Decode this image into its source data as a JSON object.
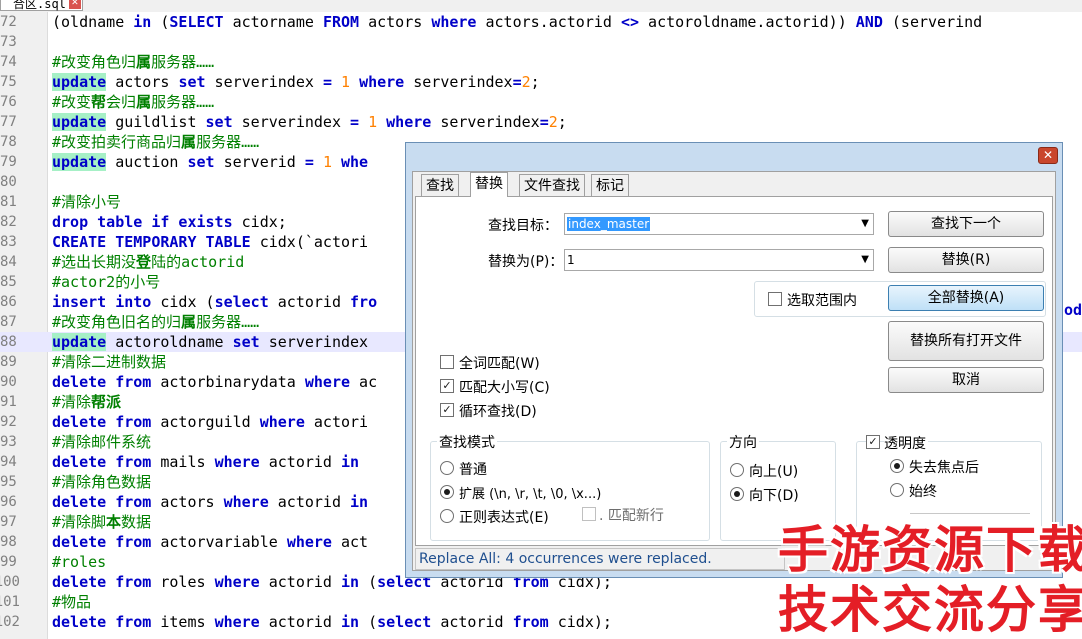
{
  "editor": {
    "tab": {
      "title": "合区.sql",
      "close_icon": "close-icon"
    },
    "lines": [
      {
        "n": "72",
        "tokens": [
          [
            "t",
            "(oldname "
          ],
          [
            "k",
            "in"
          ],
          [
            "t",
            " ("
          ],
          [
            "k",
            "SELECT"
          ],
          [
            "t",
            " actorname "
          ],
          [
            "k",
            "FROM"
          ],
          [
            "t",
            " actors "
          ],
          [
            "k",
            "where"
          ],
          [
            "t",
            " actors.actorid "
          ],
          [
            "k",
            "<>"
          ],
          [
            "t",
            " actoroldname.actorid)) "
          ],
          [
            "k",
            "AND"
          ],
          [
            "t",
            " (serverind"
          ]
        ]
      },
      {
        "n": "73",
        "tokens": []
      },
      {
        "n": "74",
        "tokens": [
          [
            "c",
            "#改变角色归"
          ],
          [
            "cb",
            "属"
          ],
          [
            "c",
            "服务器……"
          ]
        ]
      },
      {
        "n": "75",
        "tokens": [
          [
            "h",
            "update"
          ],
          [
            "t",
            " actors "
          ],
          [
            "k",
            "set"
          ],
          [
            "t",
            " serverindex "
          ],
          [
            "k",
            "="
          ],
          [
            "t",
            " "
          ],
          [
            "n",
            "1"
          ],
          [
            "t",
            " "
          ],
          [
            "k",
            "where"
          ],
          [
            "t",
            " serverindex"
          ],
          [
            "k",
            "="
          ],
          [
            "n",
            "2"
          ],
          [
            "t",
            ";"
          ]
        ]
      },
      {
        "n": "76",
        "tokens": [
          [
            "c",
            "#改变"
          ],
          [
            "cb",
            "帮"
          ],
          [
            "c",
            "会归"
          ],
          [
            "cb",
            "属"
          ],
          [
            "c",
            "服务器……"
          ]
        ]
      },
      {
        "n": "77",
        "tokens": [
          [
            "h",
            "update"
          ],
          [
            "t",
            " guildlist "
          ],
          [
            "k",
            "set"
          ],
          [
            "t",
            " serverindex "
          ],
          [
            "k",
            "="
          ],
          [
            "t",
            " "
          ],
          [
            "n",
            "1"
          ],
          [
            "t",
            " "
          ],
          [
            "k",
            "where"
          ],
          [
            "t",
            " serverindex"
          ],
          [
            "k",
            "="
          ],
          [
            "n",
            "2"
          ],
          [
            "t",
            ";"
          ]
        ]
      },
      {
        "n": "78",
        "tokens": [
          [
            "c",
            "#改变拍卖行商品归"
          ],
          [
            "cb",
            "属"
          ],
          [
            "c",
            "服务器……"
          ]
        ]
      },
      {
        "n": "79",
        "tokens": [
          [
            "h",
            "update"
          ],
          [
            "t",
            " auction "
          ],
          [
            "k",
            "set"
          ],
          [
            "t",
            " serverid "
          ],
          [
            "k",
            "="
          ],
          [
            "t",
            " "
          ],
          [
            "n",
            "1"
          ],
          [
            "t",
            " "
          ],
          [
            "k",
            "whe"
          ]
        ]
      },
      {
        "n": "80",
        "tokens": []
      },
      {
        "n": "81",
        "tokens": [
          [
            "c",
            "#清除小号"
          ]
        ]
      },
      {
        "n": "82",
        "tokens": [
          [
            "k",
            "drop table if exists"
          ],
          [
            "t",
            " cidx;"
          ]
        ]
      },
      {
        "n": "83",
        "tokens": [
          [
            "k",
            "CREATE TEMPORARY TABLE"
          ],
          [
            "t",
            " cidx(`actori"
          ]
        ]
      },
      {
        "n": "84",
        "tokens": [
          [
            "c",
            "#选出长期没"
          ],
          [
            "cb",
            "登"
          ],
          [
            "c",
            "陆的actorid"
          ]
        ]
      },
      {
        "n": "85",
        "tokens": [
          [
            "c",
            "#actor2的小号"
          ]
        ]
      },
      {
        "n": "86",
        "tokens": [
          [
            "k",
            "insert into"
          ],
          [
            "t",
            " cidx ("
          ],
          [
            "k",
            "select"
          ],
          [
            "t",
            " actorid "
          ],
          [
            "k",
            "fro"
          ]
        ]
      },
      {
        "n": "87",
        "tokens": [
          [
            "c",
            "#改变角色旧名的归"
          ],
          [
            "cb",
            "属"
          ],
          [
            "c",
            "服务器……"
          ]
        ]
      },
      {
        "n": "88",
        "tokens": [
          [
            "h",
            "update"
          ],
          [
            "t",
            " actoroldname "
          ],
          [
            "k",
            "set"
          ],
          [
            "t",
            " serverindex "
          ]
        ],
        "hl": true
      },
      {
        "n": "89",
        "tokens": [
          [
            "c",
            "#清除二进制数据"
          ]
        ]
      },
      {
        "n": "90",
        "tokens": [
          [
            "k",
            "delete from"
          ],
          [
            "t",
            " actorbinarydata "
          ],
          [
            "k",
            "where"
          ],
          [
            "t",
            " ac"
          ]
        ]
      },
      {
        "n": "91",
        "tokens": [
          [
            "c",
            "#清除"
          ],
          [
            "cb",
            "帮派"
          ]
        ]
      },
      {
        "n": "92",
        "tokens": [
          [
            "k",
            "delete from"
          ],
          [
            "t",
            " actorguild "
          ],
          [
            "k",
            "where"
          ],
          [
            "t",
            " actori"
          ]
        ]
      },
      {
        "n": "93",
        "tokens": [
          [
            "c",
            "#清除邮件系统"
          ]
        ]
      },
      {
        "n": "94",
        "tokens": [
          [
            "k",
            "delete from"
          ],
          [
            "t",
            " mails "
          ],
          [
            "k",
            "where"
          ],
          [
            "t",
            " actorid "
          ],
          [
            "k",
            "in"
          ]
        ]
      },
      {
        "n": "95",
        "tokens": [
          [
            "c",
            "#清除角色数据"
          ]
        ]
      },
      {
        "n": "96",
        "tokens": [
          [
            "k",
            "delete from"
          ],
          [
            "t",
            " actors "
          ],
          [
            "k",
            "where"
          ],
          [
            "t",
            " actorid "
          ],
          [
            "k",
            "in"
          ]
        ]
      },
      {
        "n": "97",
        "tokens": [
          [
            "c",
            "#清除脚"
          ],
          [
            "cb",
            "本"
          ],
          [
            "c",
            "数据"
          ]
        ]
      },
      {
        "n": "98",
        "tokens": [
          [
            "k",
            "delete from"
          ],
          [
            "t",
            " actorvariable "
          ],
          [
            "k",
            "where"
          ],
          [
            "t",
            " act"
          ]
        ]
      },
      {
        "n": "99",
        "tokens": [
          [
            "c",
            "#roles"
          ]
        ]
      },
      {
        "n": "100",
        "tokens": [
          [
            "k",
            "delete from"
          ],
          [
            "t",
            " roles "
          ],
          [
            "k",
            "where"
          ],
          [
            "t",
            " actorid "
          ],
          [
            "k",
            "in"
          ],
          [
            "t",
            " ("
          ],
          [
            "k",
            "select"
          ],
          [
            "t",
            " actorid "
          ],
          [
            "k",
            "from"
          ],
          [
            "t",
            " cidx);"
          ]
        ]
      },
      {
        "n": "101",
        "tokens": [
          [
            "c",
            "#物品"
          ]
        ]
      },
      {
        "n": "102",
        "tokens": [
          [
            "k",
            "delete from"
          ],
          [
            "t",
            " items "
          ],
          [
            "k",
            "where"
          ],
          [
            "t",
            " actorid "
          ],
          [
            "k",
            "in"
          ],
          [
            "t",
            " ("
          ],
          [
            "k",
            "select"
          ],
          [
            "t",
            " actorid "
          ],
          [
            "k",
            "from"
          ],
          [
            "t",
            " cidx);"
          ]
        ]
      }
    ],
    "right_edge_fragment": "od"
  },
  "dialog": {
    "close_icon": "close-icon",
    "tabs": [
      {
        "label": "查找",
        "active": false
      },
      {
        "label": "替换",
        "active": true
      },
      {
        "label": "文件查找",
        "active": false
      },
      {
        "label": "标记",
        "active": false
      }
    ],
    "find_label": "查找目标：",
    "find_value": "index_master",
    "replace_label": "替换为(P)：",
    "replace_value": "1",
    "buttons": {
      "find_next": "查找下一个",
      "replace": "替换(R)",
      "replace_all": "全部替换(A)",
      "replace_all_open": "替换所有打开文件",
      "cancel": "取消"
    },
    "in_selection": {
      "label": "选取范围内",
      "checked": false
    },
    "options": [
      {
        "label": "全词匹配(W)",
        "checked": false
      },
      {
        "label": "匹配大小写(C)",
        "checked": true
      },
      {
        "label": "循环查找(D)",
        "checked": true
      }
    ],
    "search_mode": {
      "title": "查找模式",
      "items": [
        {
          "label": "普通",
          "checked": false
        },
        {
          "label": "扩展 (\\n, \\r, \\t, \\0, \\x...)",
          "checked": true
        },
        {
          "label": "正则表达式(E)",
          "checked": false
        }
      ],
      "match_newline": ". 匹配新行"
    },
    "direction": {
      "title": "方向",
      "items": [
        {
          "label": "向上(U)",
          "checked": false
        },
        {
          "label": "向下(D)",
          "checked": true
        }
      ]
    },
    "transparency": {
      "title": "透明度",
      "checked": true,
      "items": [
        {
          "label": "失去焦点后",
          "checked": true
        },
        {
          "label": "始终",
          "checked": false
        }
      ]
    },
    "status": "Replace All: 4 occurrences were replaced."
  },
  "watermark": {
    "line1": "手游资源下载",
    "line2": "技术交流分享",
    "color": "#e41e26"
  }
}
